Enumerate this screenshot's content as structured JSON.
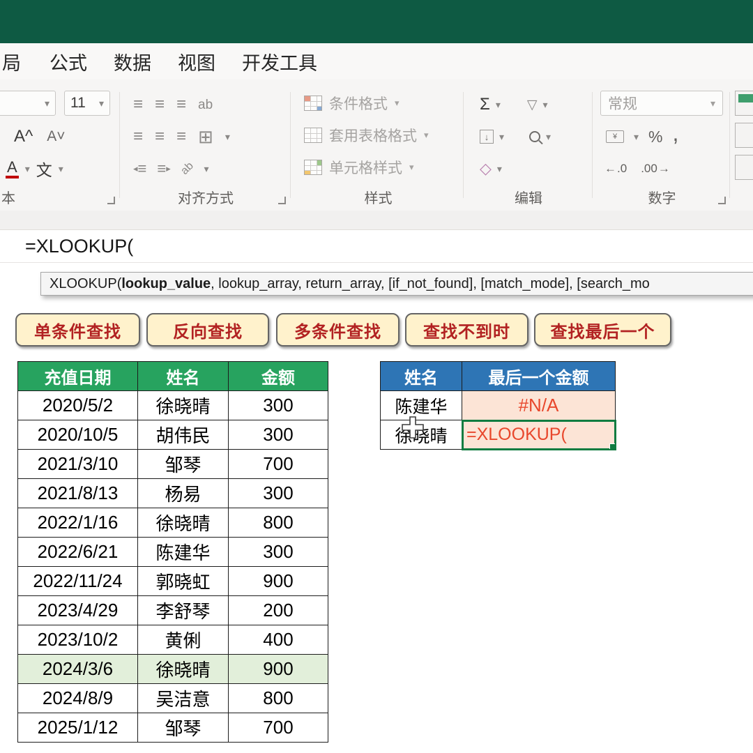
{
  "colors": {
    "titlebar": "#0E5A43",
    "left_header": "#27A35F",
    "right_header": "#2E75B5",
    "highlight_row": "#E2EFDA",
    "button_fill": "#FFF2CC",
    "button_text": "#B22222",
    "error_text": "#E8472C",
    "edit_border": "#107C41",
    "cell_fill_orange": "#FCE4D6"
  },
  "ribbon": {
    "tabs": [
      "局",
      "公式",
      "数据",
      "视图",
      "开发工具"
    ],
    "font_group": {
      "label": "本",
      "size_value": "11",
      "grow_glyph": "A^",
      "shrink_glyph": "A˅",
      "color_glyph": "A",
      "phonetic_glyph": "文"
    },
    "align_group": {
      "label": "对齐方式",
      "wrap_glyph": "ab",
      "orient_glyph": "ab"
    },
    "style_group": {
      "label": "样式",
      "items": [
        "条件格式",
        "套用表格格式",
        "单元格样式"
      ]
    },
    "edit_group": {
      "label": "编辑",
      "sum_glyph": "Σ"
    },
    "number_group": {
      "label": "数字",
      "format_value": "常规",
      "percent_glyph": "%",
      "comma_glyph": ",",
      "dec_glyph": ".0",
      "inc_glyph": ".00"
    }
  },
  "formula_bar": {
    "value": "=XLOOKUP("
  },
  "function_hint": {
    "prefix": "XLOOKUP(",
    "bold_arg": "lookup_value",
    "rest": ", lookup_array, return_array, [if_not_found], [match_mode], [search_mo"
  },
  "nav_buttons": [
    "单条件查找",
    "反向查找",
    "多条件查找",
    "查找不到时",
    "查找最后一个"
  ],
  "left_table": {
    "headers": [
      "充值日期",
      "姓名",
      "金额"
    ],
    "rows": [
      [
        "2020/5/2",
        "徐晓晴",
        "300"
      ],
      [
        "2020/10/5",
        "胡伟民",
        "300"
      ],
      [
        "2021/3/10",
        "邹琴",
        "700"
      ],
      [
        "2021/8/13",
        "杨易",
        "300"
      ],
      [
        "2022/1/16",
        "徐晓晴",
        "800"
      ],
      [
        "2022/6/21",
        "陈建华",
        "300"
      ],
      [
        "2022/11/24",
        "郭晓虹",
        "900"
      ],
      [
        "2023/4/29",
        "李舒琴",
        "200"
      ],
      [
        "2023/10/2",
        "黄俐",
        "400"
      ],
      [
        "2024/3/6",
        "徐晓晴",
        "900"
      ],
      [
        "2024/8/9",
        "吴洁意",
        "800"
      ],
      [
        "2025/1/12",
        "邹琴",
        "700"
      ]
    ],
    "highlight_row_index": 9
  },
  "right_table": {
    "headers": [
      "姓名",
      "最后一个金额"
    ],
    "rows": [
      [
        "陈建华",
        "#N/A"
      ],
      [
        "徐晓晴",
        "=XLOOKUP("
      ]
    ]
  }
}
